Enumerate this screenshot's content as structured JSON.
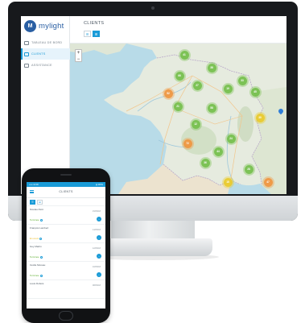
{
  "desktop": {
    "brand": "mylight",
    "brand_badge": "M",
    "nav": [
      {
        "label": "TABLEAU DE BORD",
        "icon": "dashboard-icon"
      },
      {
        "label": "CLIENTS",
        "icon": "users-icon",
        "active": true
      },
      {
        "label": "ASSISTANCE",
        "icon": "support-icon"
      }
    ],
    "page_title": "CLIENTS",
    "view_toggle": [
      "☰",
      "⊞"
    ],
    "zoom": {
      "in": "+",
      "out": "−"
    },
    "colors": {
      "accent": "#1a9bd7",
      "brand": "#2a5fa3",
      "cluster_green": "#70be46",
      "cluster_yellow": "#e9ca28",
      "cluster_orange": "#f0943c"
    }
  },
  "phone": {
    "status_left": "••••• 14:00",
    "status_right": "▮ 100%",
    "title": "CLIENTS",
    "tabs": [
      "☰",
      "⊞"
    ],
    "items": [
      {
        "name": "Nicolas Petit",
        "date": "15/06/18",
        "status": "Terminée",
        "kind": "ok"
      },
      {
        "name": "François Lambert",
        "date": "14/06/18",
        "status": "En cours",
        "kind": "warn"
      },
      {
        "name": "Guy Martin",
        "date": "12/06/18",
        "status": "Terminée",
        "kind": "ok"
      },
      {
        "name": "Cécile Moreau",
        "date": "10/06/18",
        "status": "Terminée",
        "kind": "ok"
      },
      {
        "name": "Louis Dubois",
        "date": "08/06/18",
        "status": "",
        "kind": "ok"
      }
    ]
  },
  "map": {
    "clusters": [
      {
        "label": "41",
        "color": "green"
      },
      {
        "label": "38",
        "color": "green"
      },
      {
        "label": "52",
        "color": "orange"
      },
      {
        "label": "66",
        "color": "green"
      },
      {
        "label": "27",
        "color": "green"
      },
      {
        "label": "19",
        "color": "green"
      },
      {
        "label": "33",
        "color": "green"
      },
      {
        "label": "45",
        "color": "green"
      },
      {
        "label": "21",
        "color": "green"
      },
      {
        "label": "58",
        "color": "green"
      },
      {
        "label": "30",
        "color": "yellow"
      },
      {
        "label": "72",
        "color": "orange"
      },
      {
        "label": "24",
        "color": "green"
      },
      {
        "label": "36",
        "color": "green"
      },
      {
        "label": "44",
        "color": "green"
      },
      {
        "label": "15",
        "color": "yellow"
      },
      {
        "label": "28",
        "color": "green"
      },
      {
        "label": "47",
        "color": "orange"
      },
      {
        "label": "12",
        "color": "green"
      }
    ]
  }
}
